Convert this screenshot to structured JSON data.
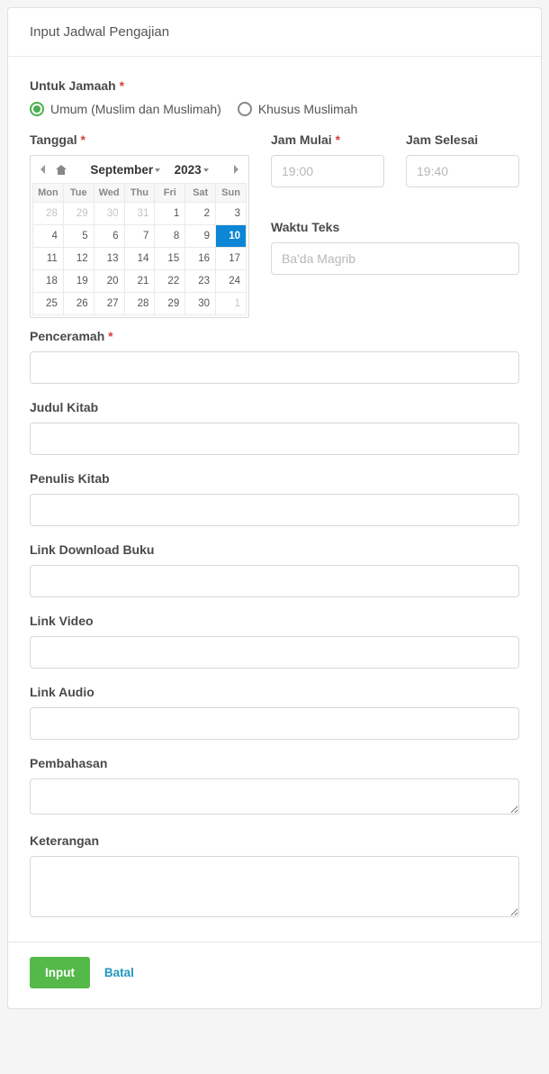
{
  "header": {
    "title": "Input Jadwal Pengajian"
  },
  "jamaah": {
    "label": "Untuk Jamaah",
    "options": [
      "Umum (Muslim dan Muslimah)",
      "Khusus Muslimah"
    ],
    "selected": 0
  },
  "tanggal": {
    "label": "Tanggal",
    "month": "September",
    "year": "2023",
    "dow": [
      "Mon",
      "Tue",
      "Wed",
      "Thu",
      "Fri",
      "Sat",
      "Sun"
    ],
    "weeks": [
      [
        {
          "d": 28,
          "o": true
        },
        {
          "d": 29,
          "o": true
        },
        {
          "d": 30,
          "o": true
        },
        {
          "d": 31,
          "o": true
        },
        {
          "d": 1
        },
        {
          "d": 2
        },
        {
          "d": 3
        }
      ],
      [
        {
          "d": 4
        },
        {
          "d": 5
        },
        {
          "d": 6
        },
        {
          "d": 7
        },
        {
          "d": 8
        },
        {
          "d": 9
        },
        {
          "d": 10,
          "sel": true
        }
      ],
      [
        {
          "d": 11
        },
        {
          "d": 12
        },
        {
          "d": 13
        },
        {
          "d": 14
        },
        {
          "d": 15
        },
        {
          "d": 16
        },
        {
          "d": 17
        }
      ],
      [
        {
          "d": 18
        },
        {
          "d": 19
        },
        {
          "d": 20
        },
        {
          "d": 21
        },
        {
          "d": 22
        },
        {
          "d": 23
        },
        {
          "d": 24
        }
      ],
      [
        {
          "d": 25
        },
        {
          "d": 26
        },
        {
          "d": 27
        },
        {
          "d": 28
        },
        {
          "d": 29
        },
        {
          "d": 30
        },
        {
          "d": 1,
          "o": true
        }
      ]
    ]
  },
  "jamMulai": {
    "label": "Jam Mulai",
    "placeholder": "19:00",
    "value": ""
  },
  "jamSelesai": {
    "label": "Jam Selesai",
    "placeholder": "19:40",
    "value": ""
  },
  "waktuTeks": {
    "label": "Waktu Teks",
    "placeholder": "Ba'da Magrib",
    "value": ""
  },
  "penceramah": {
    "label": "Penceramah",
    "value": ""
  },
  "judulKitab": {
    "label": "Judul Kitab",
    "value": ""
  },
  "penulisKitab": {
    "label": "Penulis Kitab",
    "value": ""
  },
  "linkDownload": {
    "label": "Link Download Buku",
    "value": ""
  },
  "linkVideo": {
    "label": "Link Video",
    "value": ""
  },
  "linkAudio": {
    "label": "Link Audio",
    "value": ""
  },
  "pembahasan": {
    "label": "Pembahasan",
    "value": ""
  },
  "keterangan": {
    "label": "Keterangan",
    "value": ""
  },
  "actions": {
    "submit": "Input",
    "cancel": "Batal"
  }
}
